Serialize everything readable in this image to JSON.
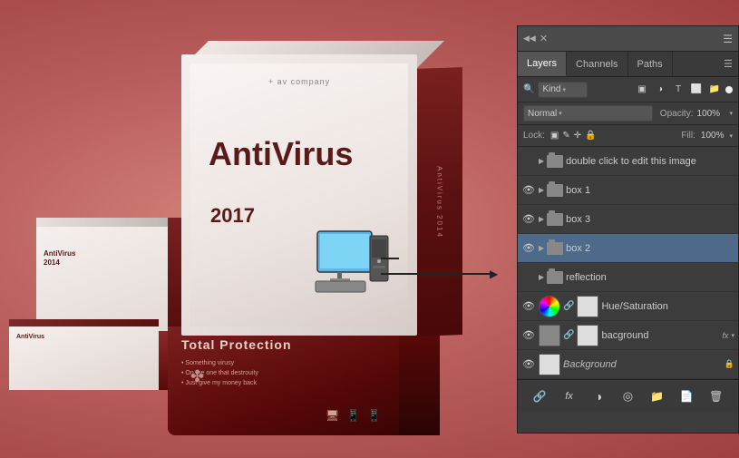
{
  "background": {
    "color": "#c47070"
  },
  "artwork": {
    "main_box": {
      "company": "+ av company",
      "title": "AntiVirus",
      "year": "2017",
      "side_text": "AntiVirus 2014"
    },
    "lying_box": {
      "text": "AntiVirus"
    },
    "total_box": {
      "title": "Total Protection",
      "bullets": [
        "• Something virusy",
        "• On the one that destrouity",
        "• Just give my money back"
      ]
    }
  },
  "panel": {
    "title": "Layers panel",
    "tabs": [
      {
        "label": "Layers",
        "active": true
      },
      {
        "label": "Channels",
        "active": false
      },
      {
        "label": "Paths",
        "active": false
      }
    ],
    "kind_label": "Kind",
    "blend_mode": "Normal",
    "opacity_label": "Opacity:",
    "opacity_value": "100%",
    "lock_label": "Lock:",
    "fill_label": "Fill:",
    "fill_value": "100%",
    "layers": [
      {
        "id": "double-click",
        "name": "double click to edit this image",
        "type": "folder",
        "eye": false,
        "expanded": false,
        "indent": 0
      },
      {
        "id": "box1",
        "name": "box 1",
        "type": "folder",
        "eye": true,
        "expanded": false,
        "indent": 0
      },
      {
        "id": "box3",
        "name": "box 3",
        "type": "folder",
        "eye": true,
        "expanded": false,
        "indent": 0
      },
      {
        "id": "box2",
        "name": "box 2",
        "type": "folder",
        "eye": true,
        "expanded": false,
        "indent": 0,
        "selected": true
      },
      {
        "id": "reflection",
        "name": "reflection",
        "type": "folder",
        "eye": false,
        "expanded": false,
        "indent": 0
      },
      {
        "id": "hue-saturation",
        "name": "Hue/Saturation",
        "type": "adjustment",
        "eye": true,
        "expanded": false,
        "indent": 0
      },
      {
        "id": "background-copy",
        "name": "bacground",
        "type": "layer-thumb",
        "eye": true,
        "expanded": false,
        "indent": 0,
        "has_fx": true
      },
      {
        "id": "background",
        "name": "Background",
        "type": "background",
        "eye": true,
        "expanded": false,
        "indent": 0,
        "locked": true,
        "italic": true
      }
    ],
    "bottom_buttons": [
      {
        "icon": "🔗",
        "name": "link-layers-button"
      },
      {
        "icon": "ƒx",
        "name": "add-layer-style-button"
      },
      {
        "icon": "◑",
        "name": "add-mask-button"
      },
      {
        "icon": "◎",
        "name": "new-adjustment-button"
      },
      {
        "icon": "📁",
        "name": "new-group-button"
      },
      {
        "icon": "📄",
        "name": "new-layer-button"
      },
      {
        "icon": "🗑",
        "name": "delete-layer-button"
      }
    ]
  }
}
